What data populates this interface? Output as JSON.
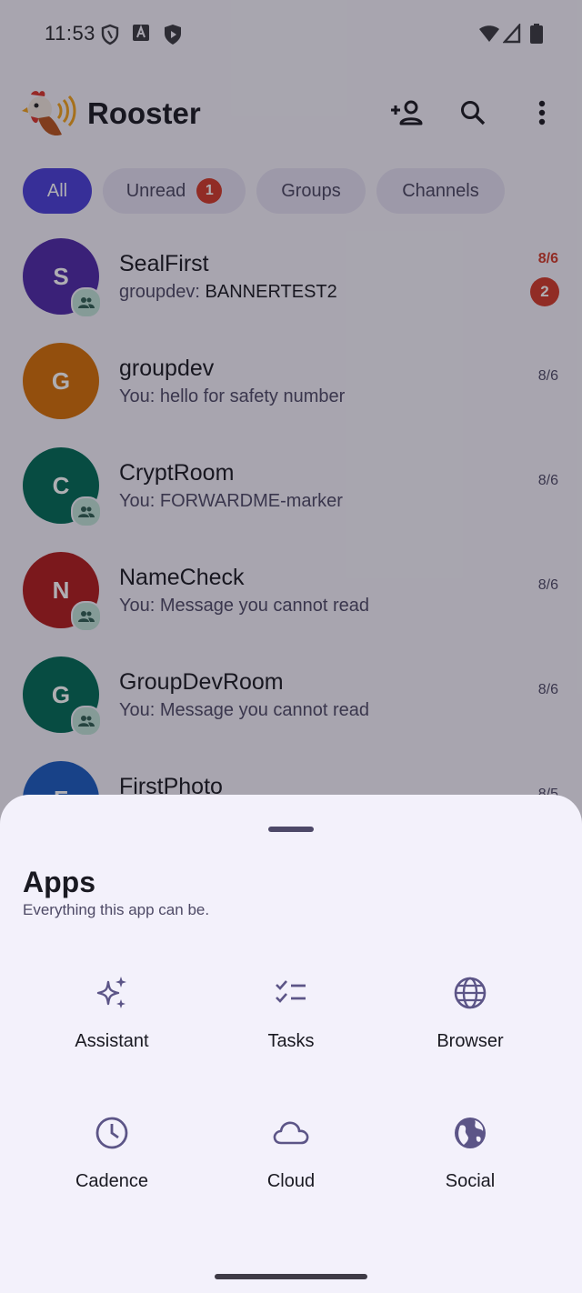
{
  "status_bar": {
    "time": "11:53",
    "left_icons": [
      "shield-outline-icon",
      "a-box-icon",
      "play-shield-icon"
    ],
    "right_icons": [
      "wifi-icon",
      "cell-signal-icon",
      "battery-icon"
    ]
  },
  "app_bar": {
    "title": "Rooster",
    "actions": [
      "add-person-icon",
      "search-icon",
      "more-vertical-icon"
    ]
  },
  "filters": [
    {
      "label": "All",
      "active": true
    },
    {
      "label": "Unread",
      "badge": "1"
    },
    {
      "label": "Groups"
    },
    {
      "label": "Channels"
    }
  ],
  "conversations": [
    {
      "initial": "S",
      "name": "SealFirst",
      "sender": "groupdev:",
      "snippet": "BANNERTEST2",
      "date": "8/6",
      "unread_count": "2",
      "color": "#4e2aa8",
      "group": true
    },
    {
      "initial": "G",
      "name": "groupdev",
      "snippet": "You: hello for safety number",
      "date": "8/6",
      "color": "#d56f06",
      "group": false
    },
    {
      "initial": "C",
      "name": "CryptRoom",
      "snippet": "You: FORWARDME-marker",
      "date": "8/6",
      "color": "#006b56",
      "group": true
    },
    {
      "initial": "N",
      "name": "NameCheck",
      "snippet": "You: Message you cannot read",
      "date": "8/6",
      "color": "#b01c1c",
      "group": true
    },
    {
      "initial": "G",
      "name": "GroupDevRoom",
      "snippet": "You: Message you cannot read",
      "date": "8/6",
      "color": "#006b56",
      "group": true
    },
    {
      "initial": "F",
      "name": "FirstPhoto",
      "snippet": "",
      "date": "8/5",
      "color": "#1a5bc0",
      "group": false
    }
  ],
  "sheet": {
    "title": "Apps",
    "subtitle": "Everything this app can be.",
    "apps": [
      {
        "label": "Assistant",
        "icon": "sparkle-icon"
      },
      {
        "label": "Tasks",
        "icon": "checklist-icon"
      },
      {
        "label": "Browser",
        "icon": "globe-icon"
      },
      {
        "label": "Cadence",
        "icon": "clock-icon"
      },
      {
        "label": "Cloud",
        "icon": "cloud-icon"
      },
      {
        "label": "Social",
        "icon": "earth-icon"
      }
    ]
  },
  "colors": {
    "accent": "#4a3fd8",
    "unread": "#d23b2a",
    "icon_purple": "#5c5587"
  }
}
